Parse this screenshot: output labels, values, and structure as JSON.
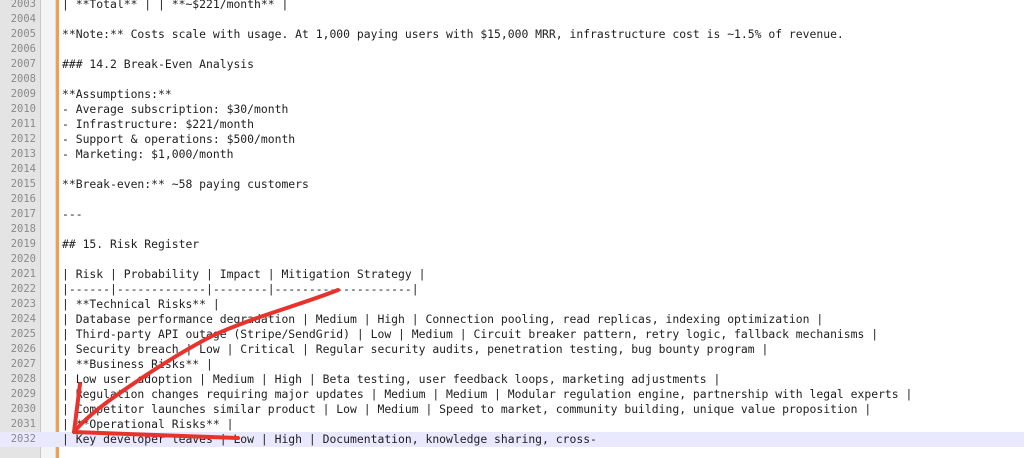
{
  "lines": [
    {
      "n": "2003",
      "text": "| **Total** | | **~$221/month** |"
    },
    {
      "n": "2004",
      "text": ""
    },
    {
      "n": "2005",
      "text": "**Note:** Costs scale with usage. At 1,000 paying users with $15,000 MRR, infrastructure cost is ~1.5% of revenue."
    },
    {
      "n": "2006",
      "text": ""
    },
    {
      "n": "2007",
      "text": "### 14.2 Break-Even Analysis"
    },
    {
      "n": "2008",
      "text": ""
    },
    {
      "n": "2009",
      "text": "**Assumptions:**"
    },
    {
      "n": "2010",
      "text": "- Average subscription: $30/month"
    },
    {
      "n": "2011",
      "text": "- Infrastructure: $221/month"
    },
    {
      "n": "2012",
      "text": "- Support & operations: $500/month"
    },
    {
      "n": "2013",
      "text": "- Marketing: $1,000/month"
    },
    {
      "n": "2014",
      "text": ""
    },
    {
      "n": "2015",
      "text": "**Break-even:** ~58 paying customers"
    },
    {
      "n": "2016",
      "text": ""
    },
    {
      "n": "2017",
      "text": "---"
    },
    {
      "n": "2018",
      "text": ""
    },
    {
      "n": "2019",
      "text": "## 15. Risk Register"
    },
    {
      "n": "2020",
      "text": ""
    },
    {
      "n": "2021",
      "text": "| Risk | Probability | Impact | Mitigation Strategy |"
    },
    {
      "n": "2022",
      "text": "|------|-------------|--------|--------------------|"
    },
    {
      "n": "2023",
      "text": "| **Technical Risks** |"
    },
    {
      "n": "2024",
      "text": "| Database performance degradation | Medium | High | Connection pooling, read replicas, indexing optimization |"
    },
    {
      "n": "2025",
      "text": "| Third-party API outage (Stripe/SendGrid) | Low | Medium | Circuit breaker pattern, retry logic, fallback mechanisms |"
    },
    {
      "n": "2026",
      "text": "| Security breach | Low | Critical | Regular security audits, penetration testing, bug bounty program |"
    },
    {
      "n": "2027",
      "text": "| **Business Risks** |"
    },
    {
      "n": "2028",
      "text": "| Low user adoption | Medium | High | Beta testing, user feedback loops, marketing adjustments |"
    },
    {
      "n": "2029",
      "text": "| Regulation changes requiring major updates | Medium | Medium | Modular regulation engine, partnership with legal experts |"
    },
    {
      "n": "2030",
      "text": "| Competitor launches similar product | Low | Medium | Speed to market, community building, unique value proposition |"
    },
    {
      "n": "2031",
      "text": "| **Operational Risks** |"
    },
    {
      "n": "2032",
      "text": "| Key developer leaves | Low | High | Documentation, knowledge sharing, cross-"
    }
  ],
  "current_line": "2032",
  "colors": {
    "annotation": "#e8322c",
    "change_bar": "#f0a04b",
    "current_line_bg": "#e8e8ff"
  }
}
